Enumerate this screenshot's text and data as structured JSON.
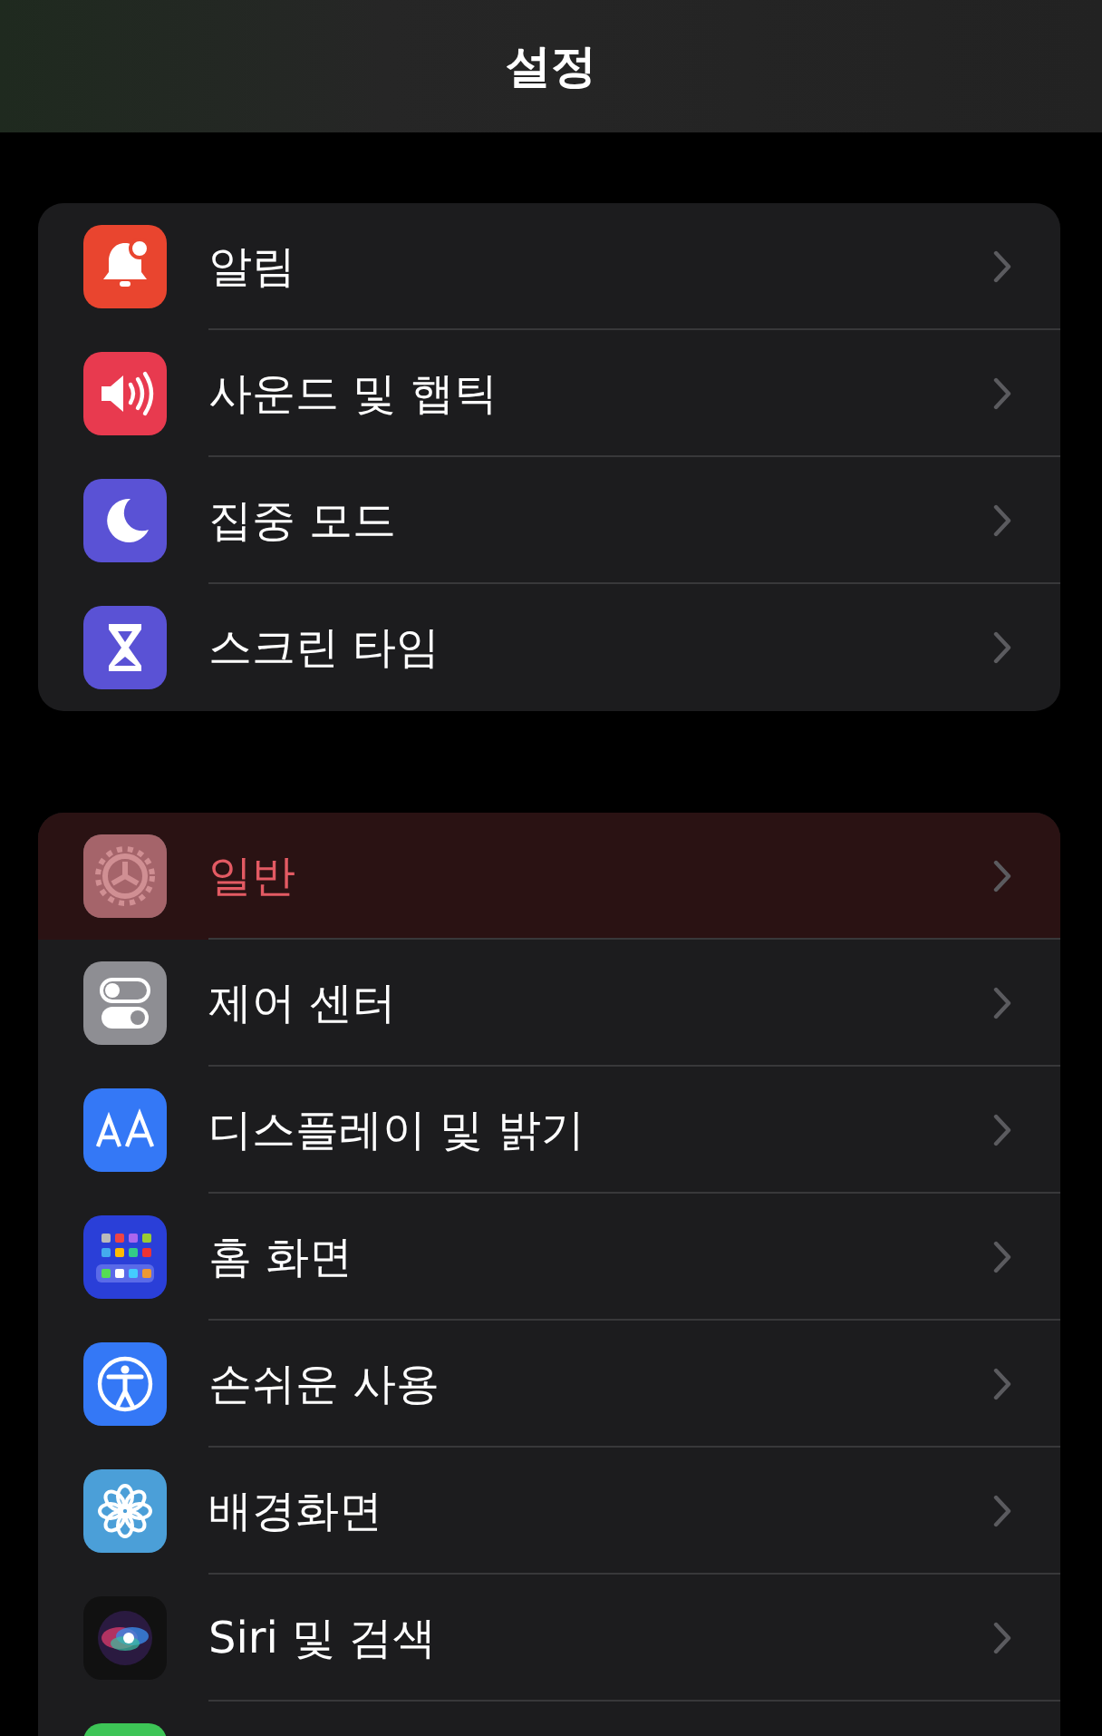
{
  "title": "설정",
  "groups": [
    {
      "items": [
        {
          "label": "알림",
          "selected": false
        },
        {
          "label": "사운드 및 햅틱",
          "selected": false
        },
        {
          "label": "집중 모드",
          "selected": false
        },
        {
          "label": "스크린 타임",
          "selected": false
        }
      ]
    },
    {
      "items": [
        {
          "label": "일반",
          "selected": true
        },
        {
          "label": "제어 센터",
          "selected": false
        },
        {
          "label": "디스플레이 및 밝기",
          "selected": false
        },
        {
          "label": "홈 화면",
          "selected": false
        },
        {
          "label": "손쉬운 사용",
          "selected": false
        },
        {
          "label": "배경화면",
          "selected": false
        },
        {
          "label": "Siri 및 검색",
          "selected": false
        }
      ]
    }
  ]
}
